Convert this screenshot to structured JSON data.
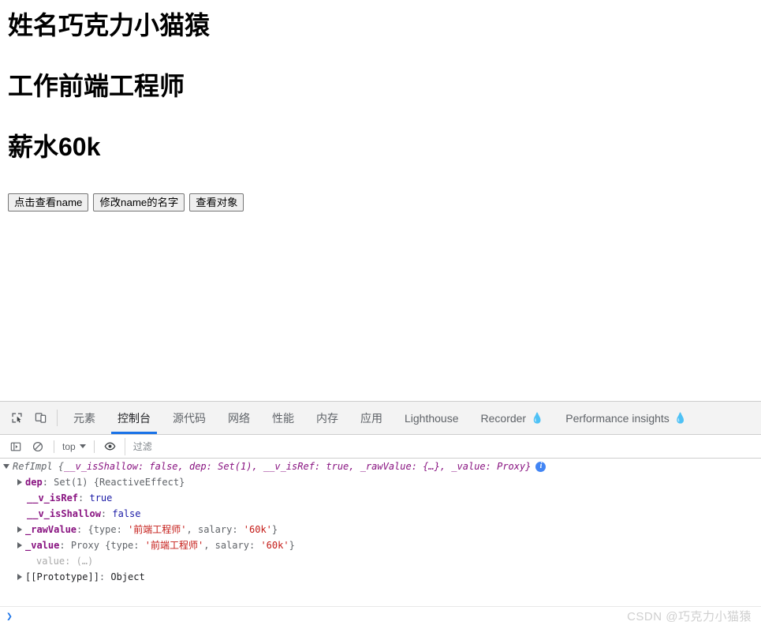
{
  "page": {
    "headings": [
      "姓名巧克力小猫猿",
      "工作前端工程师",
      "薪水60k"
    ],
    "buttons": [
      "点击查看name",
      "修改name的名字",
      "查看对象"
    ]
  },
  "devtools": {
    "tabs": [
      {
        "label": "元素",
        "active": false,
        "experimental": false
      },
      {
        "label": "控制台",
        "active": true,
        "experimental": false
      },
      {
        "label": "源代码",
        "active": false,
        "experimental": false
      },
      {
        "label": "网络",
        "active": false,
        "experimental": false
      },
      {
        "label": "性能",
        "active": false,
        "experimental": false
      },
      {
        "label": "内存",
        "active": false,
        "experimental": false
      },
      {
        "label": "应用",
        "active": false,
        "experimental": false
      },
      {
        "label": "Lighthouse",
        "active": false,
        "experimental": false
      },
      {
        "label": "Recorder",
        "active": false,
        "experimental": true
      },
      {
        "label": "Performance insights",
        "active": false,
        "experimental": true
      }
    ],
    "icons": {
      "inspect": "inspect-element-icon",
      "device": "device-toolbar-icon",
      "sidebar": "console-sidebar-icon",
      "clear": "clear-console-icon",
      "eye": "live-expressions-icon",
      "flask": "experimental-flask-icon"
    },
    "filterbar": {
      "context": "top",
      "filter_placeholder": "过滤",
      "filter_value": ""
    },
    "console": {
      "line1": {
        "class_name": "RefImpl",
        "open_brace": " {",
        "preview": "__v_isShallow: false, dep: Set(1), __v_isRef: true, _rawValue: {…}, _value: Proxy}",
        "badge": "i"
      },
      "rows": [
        {
          "expandable": true,
          "indent": 1,
          "name": "dep",
          "sep": ": ",
          "value": "Set(1) {ReactiveEffect}",
          "value_kind": "obj"
        },
        {
          "expandable": false,
          "indent": 2,
          "name": "__v_isRef",
          "sep": ": ",
          "value": "true",
          "value_kind": "bool"
        },
        {
          "expandable": false,
          "indent": 2,
          "name": "__v_isShallow",
          "sep": ": ",
          "value": "false",
          "value_kind": "bool"
        },
        {
          "expandable": true,
          "indent": 1,
          "name": "_rawValue",
          "sep": ": ",
          "prefix": "{type: ",
          "str1": "'前端工程师'",
          "mid": ", salary: ",
          "str2": "'60k'",
          "suffix": "}",
          "value_kind": "mixed"
        },
        {
          "expandable": true,
          "indent": 1,
          "name": "_value",
          "sep": ": ",
          "prefix": "Proxy {type: ",
          "str1": "'前端工程师'",
          "mid": ", salary: ",
          "str2": "'60k'",
          "suffix": "}",
          "value_kind": "mixed"
        },
        {
          "expandable": false,
          "indent": 2,
          "name": "value",
          "sep": ": ",
          "value": "(…)",
          "value_kind": "dim",
          "name_kind": "dim"
        },
        {
          "expandable": true,
          "indent": 1,
          "name": "[[Prototype]]",
          "sep": ": ",
          "value": "Object",
          "value_kind": "proto",
          "name_kind": "proto"
        }
      ],
      "prompt_chevron": "❯",
      "prompt_value": "",
      "prompt_placeholder": ""
    }
  },
  "watermark": "CSDN @巧克力小猫猿",
  "colors": {
    "accent": "#1a73e8",
    "string": "#c41a16",
    "property": "#881280",
    "boolean": "#1a1aa6",
    "muted": "#5f6368"
  }
}
